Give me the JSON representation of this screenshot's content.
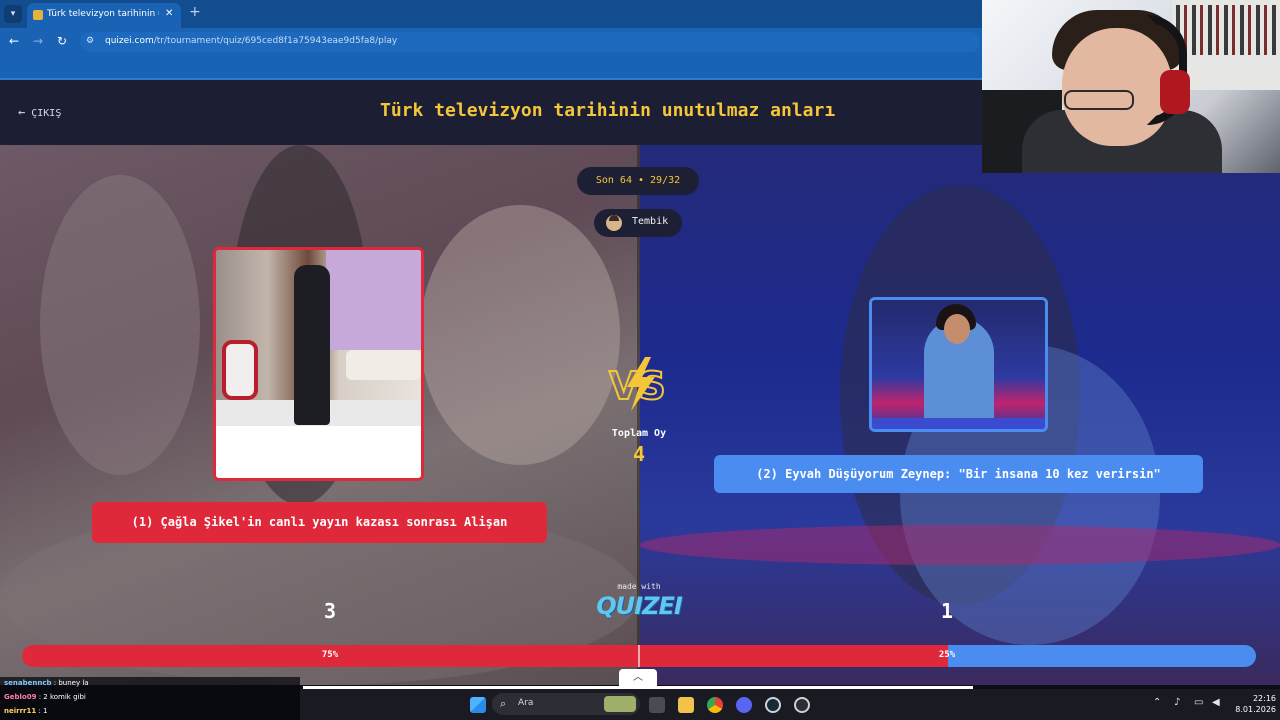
{
  "browser": {
    "tab_title": "Türk televizyon tarihinin unutulr",
    "url_host": "quizei.com",
    "url_path": "/tr/tournament/quiz/695ced8f1a75943eae9d5fa8/play"
  },
  "header": {
    "exit_label": "ÇIKIŞ",
    "quiz_title": "Türk televizyon tarihinin unutulmaz anları"
  },
  "round": {
    "label": "Son 64 • 29/32",
    "user_name": "Tembik"
  },
  "options": {
    "left_label": "(1) Çağla Şikel'in canlı yayın kazası sonrası Alişan",
    "right_label": "(2) Eyvah Düşüyorum Zeynep: \"Bir insana 10 kez verirsin\"",
    "left_votes": "3",
    "right_votes": "1",
    "left_pct_label": "75%",
    "right_pct_label": "25%",
    "left_fraction": 0.75
  },
  "center": {
    "vs_text": "VS",
    "total_label": "Toplam Oy",
    "total_value": "4",
    "made_with": "made with",
    "logo_text": "QUIZEI"
  },
  "chat": [
    {
      "user": "senabenncb",
      "msg": "buney la",
      "color": "#7ec8ff"
    },
    {
      "user": "Geblo09",
      "msg": "2 komik gibi",
      "color": "#ff7fb0"
    },
    {
      "user": "neirrr11",
      "msg": "1",
      "color": "#ffd45e"
    }
  ],
  "taskbar": {
    "search_placeholder": "Ara",
    "time": "22:16",
    "date": "8.01.2026"
  },
  "colors": {
    "red_accent": "#e0283b",
    "blue_accent": "#4a8cf0",
    "title_yellow": "#f5c53a",
    "header_bg": "#1c1f33"
  }
}
